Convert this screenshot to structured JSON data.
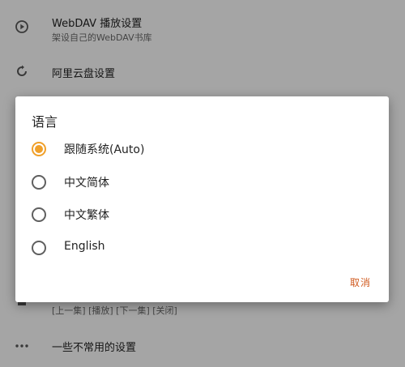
{
  "settings": {
    "webdav": {
      "title": "WebDAV 播放设置",
      "subtitle": "架设自己的WebDAV书库"
    },
    "aliyun": {
      "title": "阿里云盘设置"
    },
    "controls": {
      "subtitle": "[上一集] [播放] [下一集] [关闭]"
    },
    "misc": {
      "title": "一些不常用的设置"
    }
  },
  "dialog": {
    "title": "语言",
    "options": [
      {
        "label": "跟随系统(Auto)",
        "selected": true
      },
      {
        "label": "中文简体",
        "selected": false
      },
      {
        "label": "中文繁体",
        "selected": false
      },
      {
        "label": "English",
        "selected": false
      }
    ],
    "cancel_label": "取消"
  },
  "colors": {
    "accent": "#f0a02a",
    "cancel": "#d05a1f"
  }
}
